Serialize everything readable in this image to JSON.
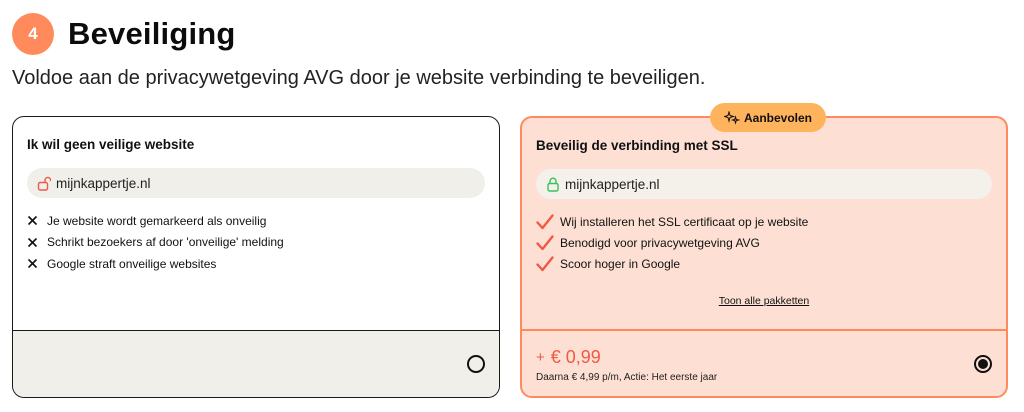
{
  "step": {
    "number": "4",
    "title": "Beveiliging",
    "subtitle": "Voldoe aan de privacywetgeving AVG door je website verbinding te beveiligen."
  },
  "colors": {
    "accent": "#ff8a5b",
    "badge": "#ffb35c",
    "price": "#ef5a47",
    "check": "#ef5a47",
    "secure_lock": "#3cbf5c",
    "insecure_lock": "#ef5a47"
  },
  "option_insecure": {
    "title": "Ik wil geen veilige website",
    "domain": "mijnkappertje.nl",
    "lock_icon": "unlocked-lock-icon",
    "items": [
      "Je website wordt gemarkeerd als onveilig",
      "Schrikt bezoekers af door 'onveilige' melding",
      "Google straft onveilige websites"
    ],
    "item_icon": "x-icon",
    "selected": false
  },
  "option_ssl": {
    "badge": "Aanbevolen",
    "badge_icon": "sparkle-icon",
    "title": "Beveilig de verbinding met SSL",
    "domain": "mijnkappertje.nl",
    "lock_icon": "locked-lock-icon",
    "items": [
      "Wij installeren het SSL certificaat op je website",
      "Benodigd voor privacywetgeving AVG",
      "Scoor hoger in Google"
    ],
    "item_icon": "check-icon",
    "link": "Toon alle pakketten",
    "price_prefix": "+",
    "price": "€ 0,99",
    "price_note": "Daarna € 4,99 p/m, Actie: Het eerste jaar",
    "selected": true
  }
}
